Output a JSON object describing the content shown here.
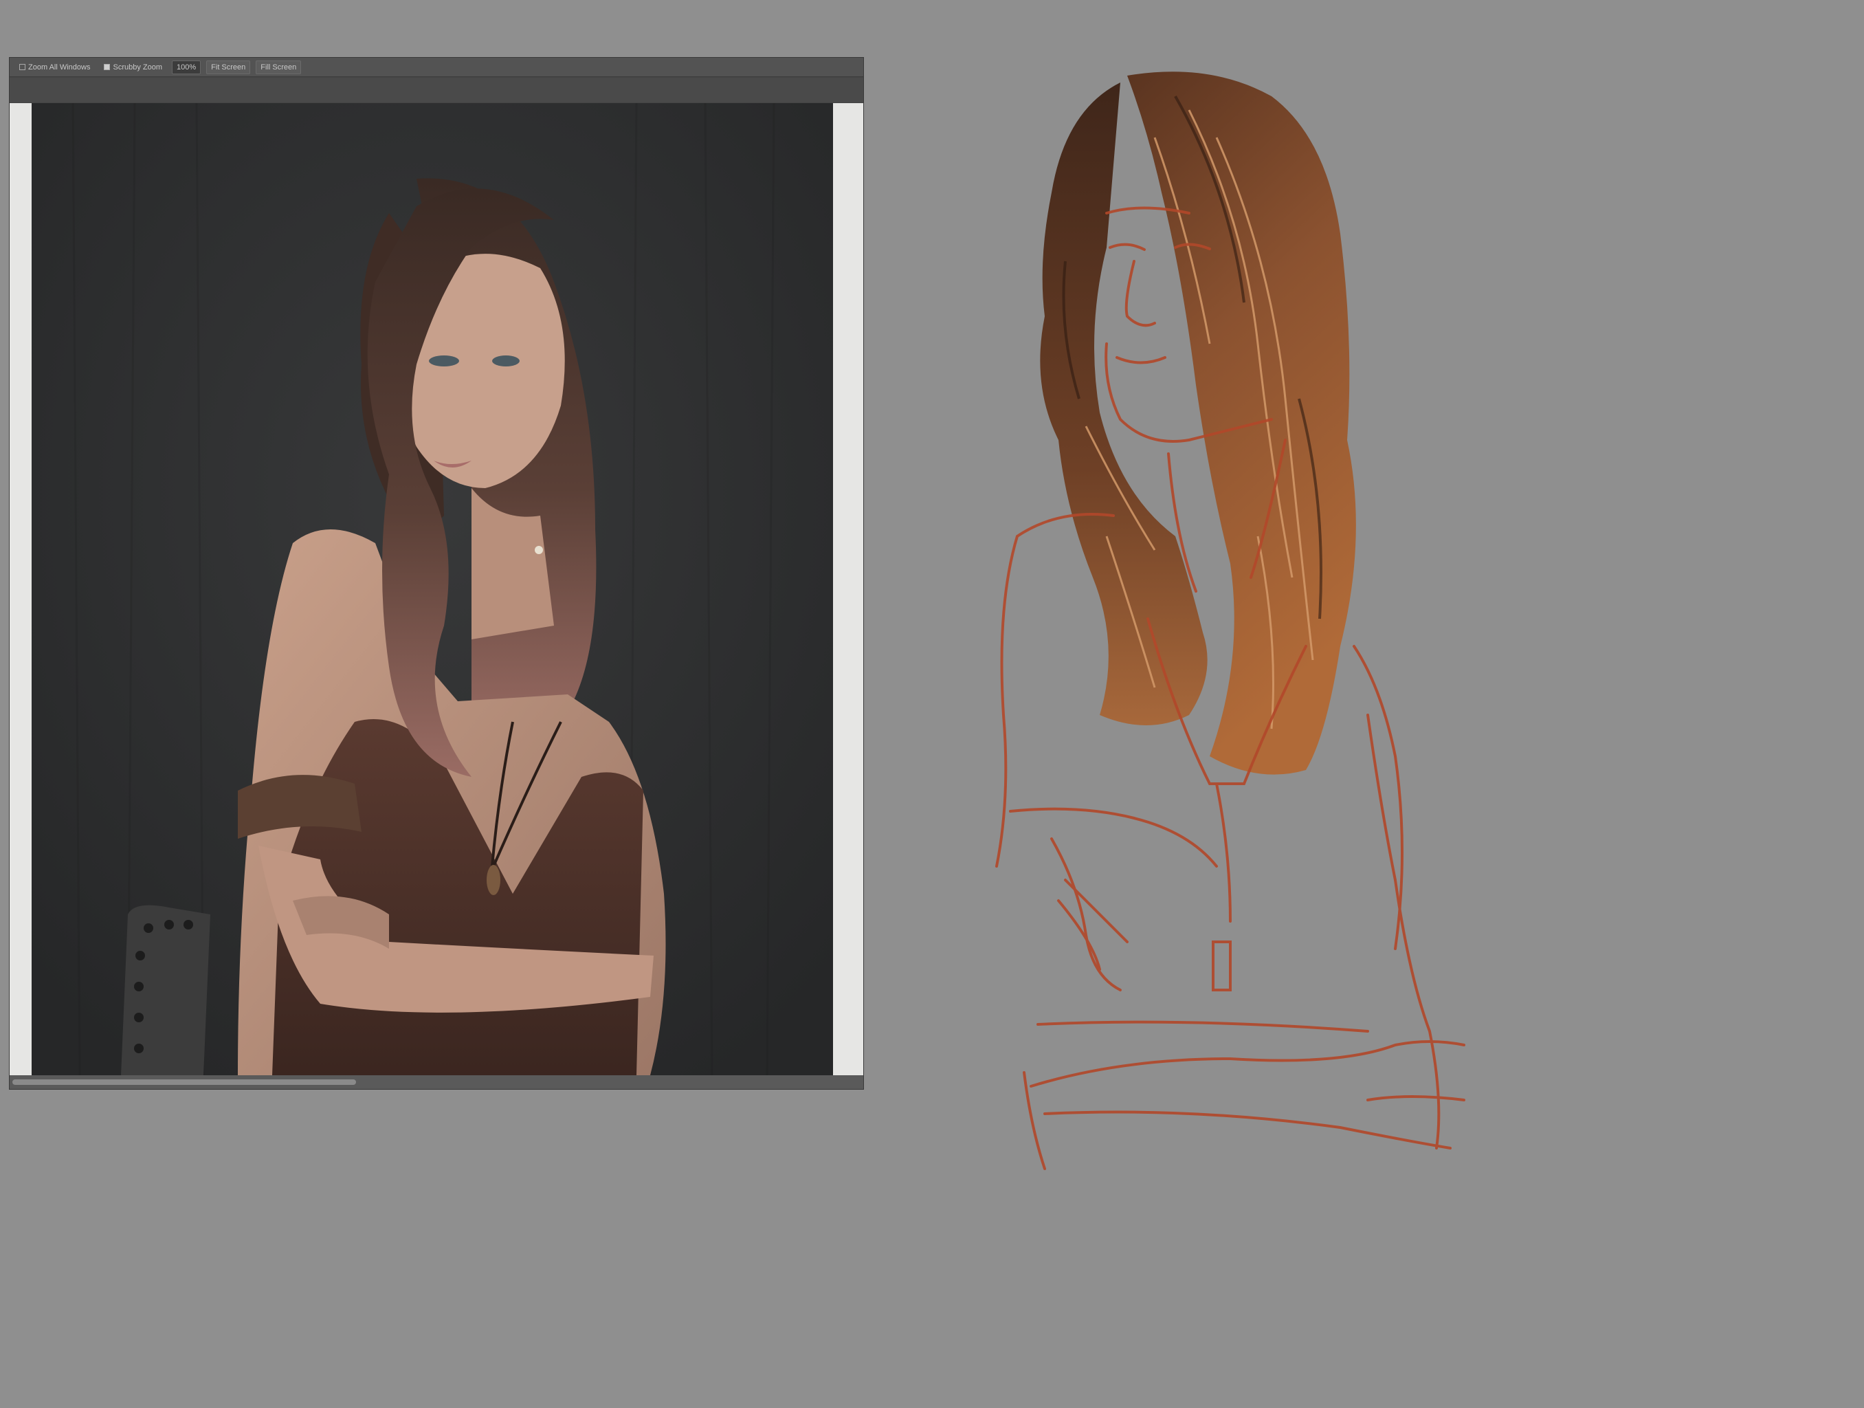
{
  "reference_window": {
    "toolbar": {
      "zoom_all_windows_label": "Zoom All Windows",
      "scrubby_zoom_label": "Scrubby Zoom",
      "zoom_value": "100%",
      "fit_screen_label": "Fit Screen",
      "fill_screen_label": "Fill Screen"
    }
  },
  "colors": {
    "canvas_gray": "#8f8f8f",
    "sketch_line": "#b2482a",
    "hair_dark": "#4a2c1c",
    "hair_mid": "#8b5230",
    "hair_light": "#c98a5a"
  }
}
